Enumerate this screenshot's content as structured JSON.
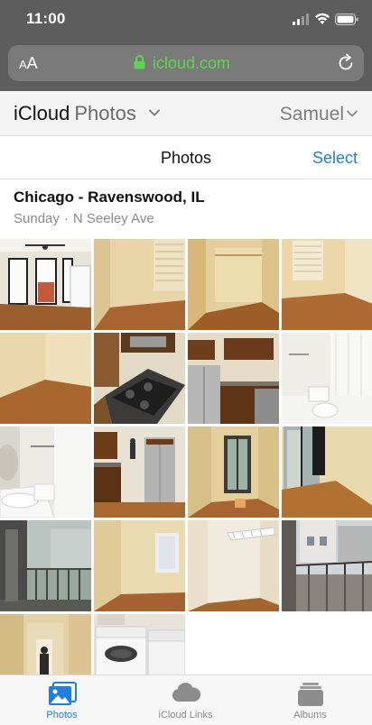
{
  "status_bar": {
    "time": "11:00"
  },
  "browser": {
    "text_size_label_small": "A",
    "text_size_label_large": "A",
    "domain": "icloud.com",
    "colors": {
      "domain": "#5dd64f"
    }
  },
  "header": {
    "app_name": "iCloud",
    "section_name": "Photos",
    "user_name": "Samuel"
  },
  "toolbar": {
    "title": "Photos",
    "select_label": "Select"
  },
  "moment": {
    "title": "Chicago - Ravenswood, IL",
    "day": "Sunday",
    "separator": "·",
    "street": "N Seeley Ave"
  },
  "photos": [
    {
      "subject": "living room with windows and ceiling fan"
    },
    {
      "subject": "empty room corner with window blinds"
    },
    {
      "subject": "closet with shelf"
    },
    {
      "subject": "room with window blinds"
    },
    {
      "subject": "empty room corner"
    },
    {
      "subject": "kitchen with gas stove"
    },
    {
      "subject": "kitchen with refrigerator and cabinets"
    },
    {
      "subject": "bathroom with tub and toilet"
    },
    {
      "subject": "bathroom with sink and towel bar"
    },
    {
      "subject": "kitchen with stainless appliances"
    },
    {
      "subject": "room with balcony door"
    },
    {
      "subject": "room with balcony door and curtain"
    },
    {
      "subject": "balcony view"
    },
    {
      "subject": "empty room with window"
    },
    {
      "subject": "closet with wire shelf"
    },
    {
      "subject": "back porch view"
    },
    {
      "subject": "hallway with door"
    },
    {
      "subject": "washer and dryer"
    }
  ],
  "tabs": [
    {
      "label": "Photos",
      "icon": "photos-icon",
      "active": true
    },
    {
      "label": "iCloud Links",
      "icon": "cloud-icon",
      "active": false
    },
    {
      "label": "Albums",
      "icon": "albums-icon",
      "active": false
    }
  ],
  "colors": {
    "accent": "#1f7ee0",
    "chrome": "#5d5d5d"
  }
}
